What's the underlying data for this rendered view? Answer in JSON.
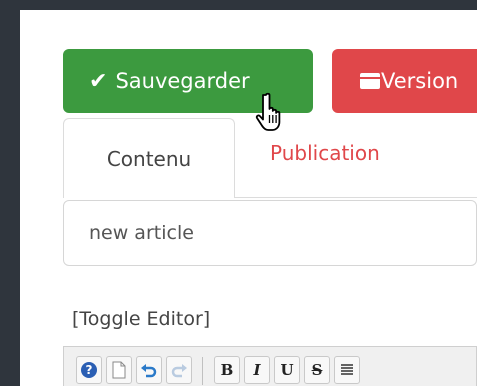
{
  "toolbar": {
    "save_label": "Sauvegarder",
    "version_label": "Version"
  },
  "tabs": [
    {
      "label": "Contenu",
      "active": true
    },
    {
      "label": "Publication",
      "active": false
    }
  ],
  "title_field": {
    "value": "new article"
  },
  "toggle_editor": "[Toggle Editor]",
  "editor_toolbar": {
    "buttons": [
      {
        "name": "help-icon"
      },
      {
        "name": "new-document-icon"
      },
      {
        "name": "undo-icon"
      },
      {
        "name": "redo-icon"
      },
      {
        "name": "bold-button",
        "label": "B"
      },
      {
        "name": "italic-button",
        "label": "I"
      },
      {
        "name": "underline-button",
        "label": "U"
      },
      {
        "name": "strikethrough-button",
        "label": "S"
      },
      {
        "name": "align-icon"
      }
    ]
  },
  "colors": {
    "save": "#3c9a3f",
    "version": "#e0474a",
    "tab_inactive_text": "#e0474a",
    "frame_background": "#2f353d"
  }
}
